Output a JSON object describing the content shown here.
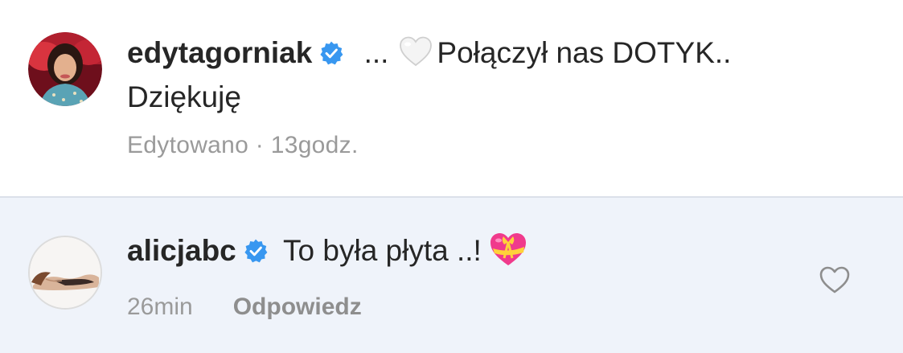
{
  "caption": {
    "username": "edytagorniak",
    "verified_icon": "verified-badge-icon",
    "ellipsis": "...",
    "emoji": "white-heart-icon",
    "text_line1": "Połączył nas DOTYK..",
    "text_line2": "Dziękuję",
    "edited_label": "Edytowano",
    "separator": "·",
    "timestamp": "13godz."
  },
  "comment": {
    "username": "alicjabc",
    "verified_icon": "verified-badge-icon",
    "text": "To była płyta ..!",
    "emoji": "heart-with-ribbon-icon",
    "timestamp": "26min",
    "reply_label": "Odpowiedz",
    "like_icon": "heart-outline-icon"
  },
  "colors": {
    "verified_blue": "#3897f0",
    "text_primary": "#262626",
    "text_secondary": "#9a9a9a",
    "comment_bg": "#eff3fa",
    "divider": "#dbe0ea"
  }
}
